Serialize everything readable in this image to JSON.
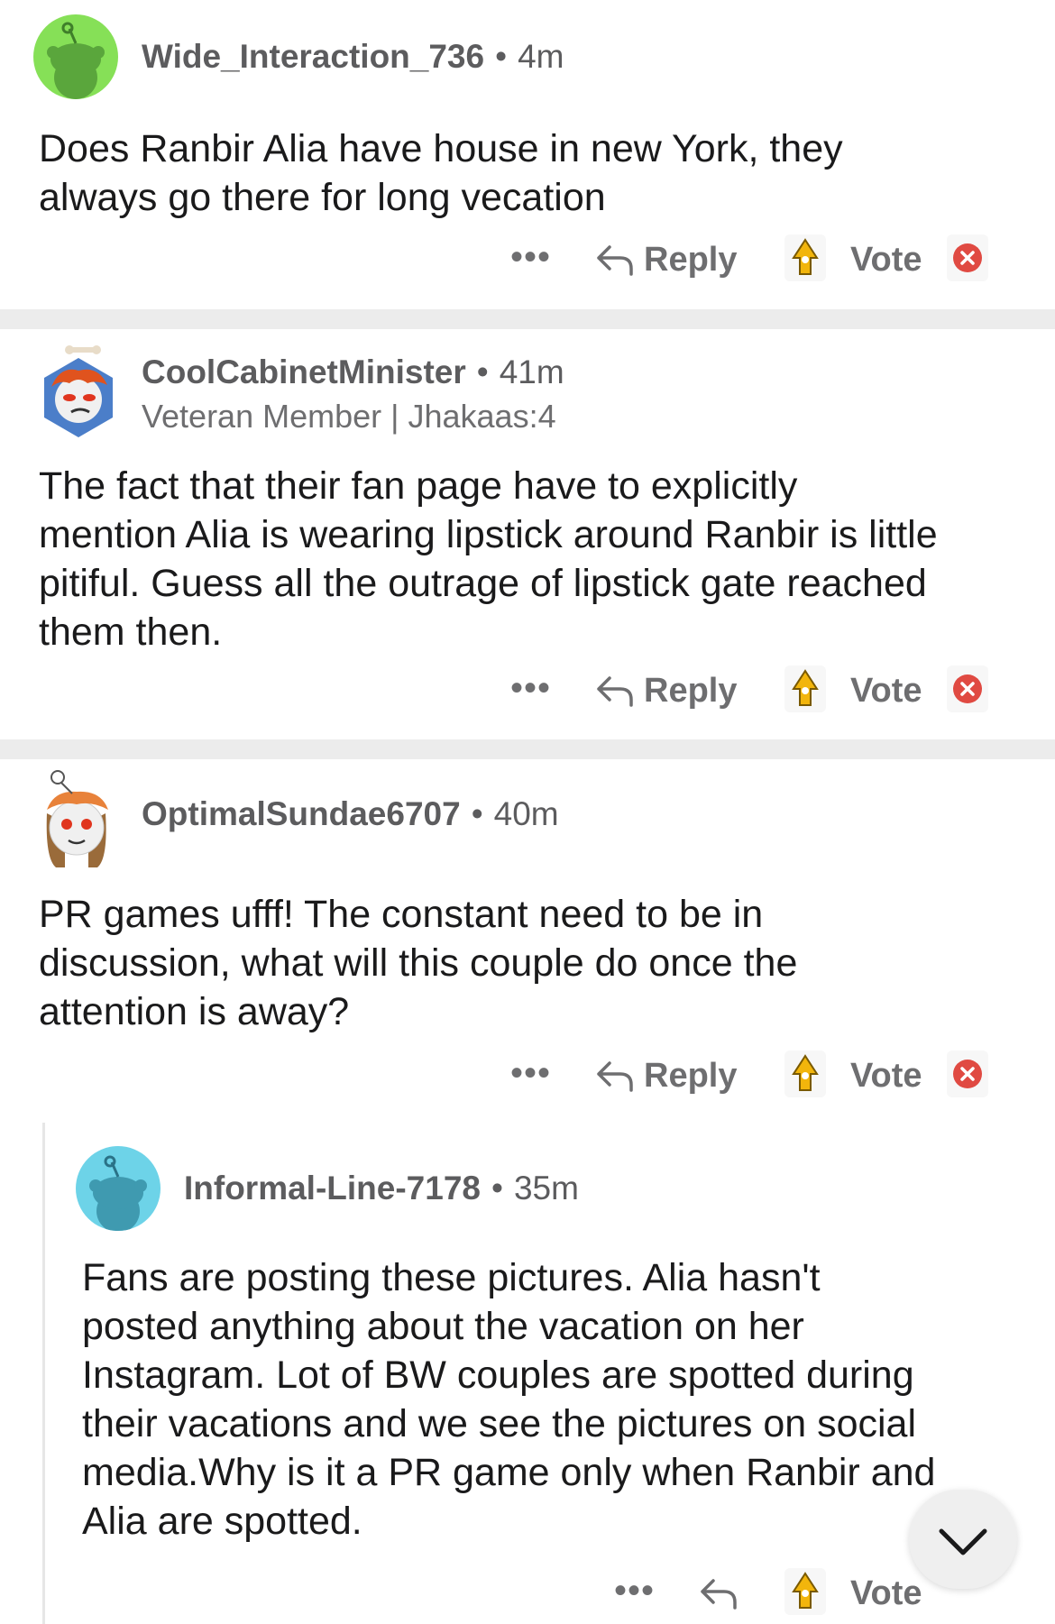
{
  "comments": [
    {
      "username": "Wide_Interaction_736",
      "time": "4m",
      "body_lines": [
        "Does Ranbir Alia have house in new York, they",
        "always go there for long vecation"
      ],
      "reply": "Reply",
      "vote": "Vote",
      "avatar": "snoo-green-avatar"
    },
    {
      "username": "CoolCabinetMinister",
      "time": "41m",
      "flair": "Veteran Member | Jhakaas:4",
      "body_lines": [
        "The fact that their fan page have to explicitly",
        "mention Alia is wearing lipstick around Ranbir is little",
        "pitiful. Guess all the outrage of lipstick gate reached",
        "them then."
      ],
      "reply": "Reply",
      "vote": "Vote",
      "avatar": "snoo-orange-hair-avatar"
    },
    {
      "username": "OptimalSundae6707",
      "time": "40m",
      "body_lines": [
        "PR games ufff! The constant need to be in",
        "discussion, what will this couple do once the",
        "attention is away?"
      ],
      "reply": "Reply",
      "vote": "Vote",
      "avatar": "snoo-bandana-avatar"
    },
    {
      "username": "Informal-Line-7178",
      "time": "35m",
      "body_lines": [
        "Fans are posting these pictures. Alia hasn't",
        "posted anything about the vacation on her",
        "Instagram. Lot of BW couples are spotted during",
        "their vacations and we see the pictures on social",
        "media.Why is it a PR game only when Ranbir and",
        "Alia are spotted."
      ],
      "vote": "Vote",
      "avatar": "snoo-blue-avatar"
    }
  ],
  "ui": {
    "dot": "•",
    "more": "•••",
    "colors": {
      "green_avatar": "#86e057",
      "blue_avatar": "#6dd3e8",
      "vote_up": "#f2b50c",
      "vote_down": "#e04a42"
    }
  }
}
